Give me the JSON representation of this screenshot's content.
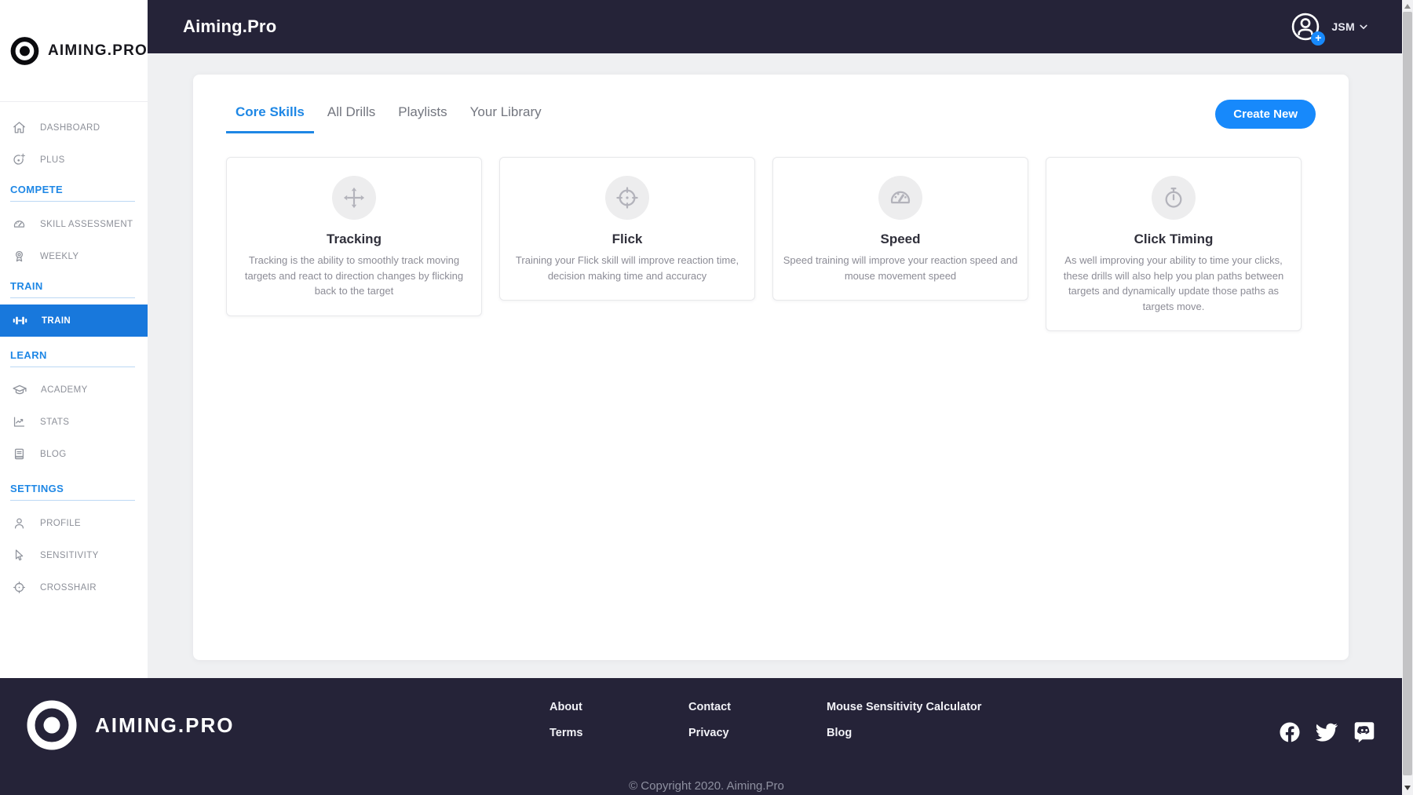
{
  "brand": {
    "logo_text": "AIMING.PRO"
  },
  "header": {
    "title": "Aiming.Pro",
    "user_initials": "JSM"
  },
  "sidebar": {
    "sections": [
      {
        "items": [
          {
            "label": "DASHBOARD",
            "icon": "home-icon"
          },
          {
            "label": "PLUS",
            "icon": "target-plus-icon"
          }
        ]
      },
      {
        "header": "COMPETE",
        "items": [
          {
            "label": "SKILL ASSESSMENT",
            "icon": "speedometer-icon"
          },
          {
            "label": "WEEKLY",
            "icon": "medal-icon"
          }
        ]
      },
      {
        "header": "TRAIN",
        "items": [
          {
            "label": "TRAIN",
            "icon": "dumbbell-icon",
            "active": true
          }
        ]
      },
      {
        "header": "LEARN",
        "items": [
          {
            "label": "ACADEMY",
            "icon": "graduation-cap-icon"
          },
          {
            "label": "STATS",
            "icon": "chart-icon"
          },
          {
            "label": "BLOG",
            "icon": "journal-icon"
          }
        ]
      },
      {
        "header": "SETTINGS",
        "items": [
          {
            "label": "PROFILE",
            "icon": "user-icon"
          },
          {
            "label": "SENSITIVITY",
            "icon": "cursor-icon"
          },
          {
            "label": "CROSSHAIR",
            "icon": "crosshair-icon"
          }
        ]
      }
    ]
  },
  "main": {
    "tabs": [
      {
        "label": "Core Skills",
        "active": true
      },
      {
        "label": "All Drills",
        "active": false
      },
      {
        "label": "Playlists",
        "active": false
      },
      {
        "label": "Your Library",
        "active": false
      }
    ],
    "create_button_label": "Create New",
    "cards": [
      {
        "icon": "move-arrows-icon",
        "title": "Tracking",
        "description": "Tracking is the ability to smoothly track moving targets and react to direction changes by flicking back to the target"
      },
      {
        "icon": "crosshair-icon",
        "title": "Flick",
        "description": "Training your Flick skill will improve reaction time, decision making time and accuracy"
      },
      {
        "icon": "speedometer-icon",
        "title": "Speed",
        "description": "Speed training will improve your reaction speed and mouse movement speed"
      },
      {
        "icon": "stopwatch-icon",
        "title": "Click Timing",
        "description": "As well improving your ability to time your clicks, these drills will also help you plan paths between targets and dynamically update those paths as targets move."
      }
    ]
  },
  "footer": {
    "brand": "AIMING.PRO",
    "link_columns": [
      {
        "links": [
          "About",
          "Terms"
        ]
      },
      {
        "links": [
          "Contact",
          "Privacy"
        ]
      },
      {
        "links": [
          "Mouse Sensitivity Calculator",
          "Blog"
        ]
      }
    ],
    "social": [
      "facebook",
      "twitter",
      "discord"
    ],
    "copyright": "© Copyright 2020. Aiming.Pro"
  },
  "colors": {
    "dark_navy": "#252338",
    "accent_blue": "#1e87e5",
    "active_item_blue": "#1878dc",
    "button_blue": "#1789fb",
    "page_background": "#eff0f2"
  }
}
